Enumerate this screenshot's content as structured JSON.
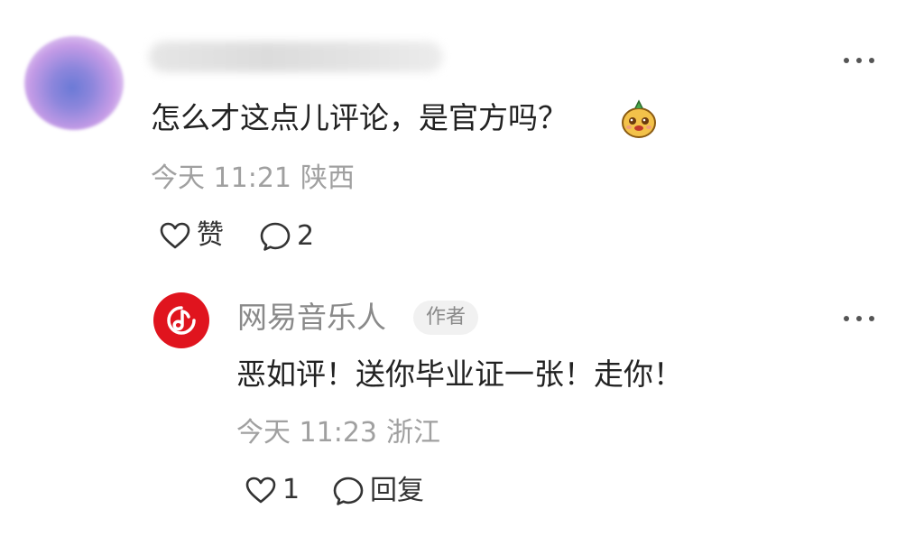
{
  "comment": {
    "text": "怎么才这点儿评论，是官方吗？",
    "time": "今天 11:21",
    "location": "陕西",
    "like_label": "赞",
    "reply_count": "2"
  },
  "reply": {
    "author": "网易音乐人",
    "badge": "作者",
    "text": "恶如评！送你毕业证一张！走你！",
    "time": "今天 11:23",
    "location": "浙江",
    "like_count": "1",
    "reply_label": "回复"
  },
  "icons": {
    "more": "more-dots-icon",
    "like": "heart-outline-icon",
    "reply": "comment-bubble-icon",
    "emoji": "cheeky-face-emoji",
    "logo": "netease-music-logo"
  },
  "colors": {
    "brand_red": "#e0141e",
    "meta_gray": "#a0a0a0",
    "text_dark": "#222222"
  }
}
